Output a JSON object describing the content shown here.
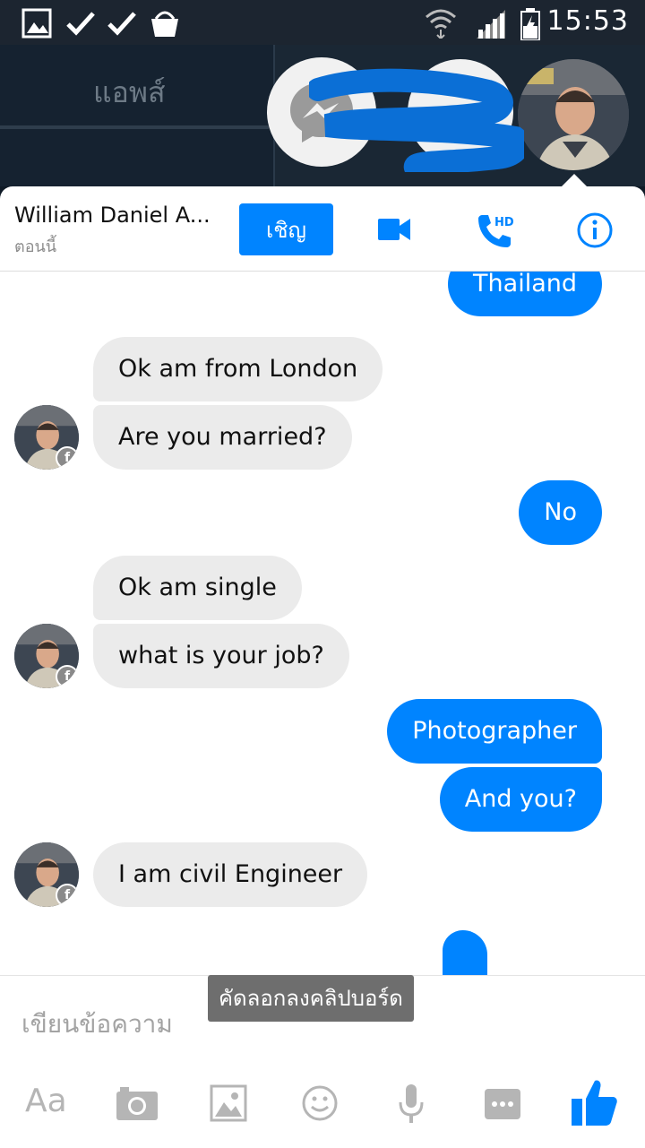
{
  "statusbar": {
    "time": "15:53"
  },
  "appbar": {
    "apps_label": "แอพส์"
  },
  "chat": {
    "contact_name": "William Daniel A...",
    "status": "ตอนนี้",
    "invite_label": "เชิญ",
    "hd_label": "HD"
  },
  "messages": [
    {
      "dir": "out",
      "text": "Thailand"
    },
    {
      "dir": "in",
      "text": "Ok am from London"
    },
    {
      "dir": "in",
      "text": "Are you married?"
    },
    {
      "dir": "out",
      "text": "No"
    },
    {
      "dir": "in",
      "text": "Ok am single"
    },
    {
      "dir": "in",
      "text": "what is your job?"
    },
    {
      "dir": "out",
      "text": "Photographer"
    },
    {
      "dir": "out",
      "text": "And you?"
    },
    {
      "dir": "in",
      "text": "I am civil Engineer"
    }
  ],
  "composer": {
    "placeholder": "เขียนข้อความ",
    "aa_label": "Aa"
  },
  "toast": {
    "text": "คัดลอกลงคลิปบอร์ด"
  },
  "colors": {
    "accent": "#0084ff",
    "bubble_in": "#ebebeb"
  },
  "icons": [
    "gallery-icon",
    "check-icon",
    "check-icon",
    "basket-icon",
    "wifi-icon",
    "signal-icon",
    "battery-icon",
    "messenger-icon",
    "video-call-icon",
    "hd-call-icon",
    "info-icon",
    "camera-icon",
    "image-icon",
    "emoji-icon",
    "mic-icon",
    "more-icon",
    "like-icon"
  ]
}
